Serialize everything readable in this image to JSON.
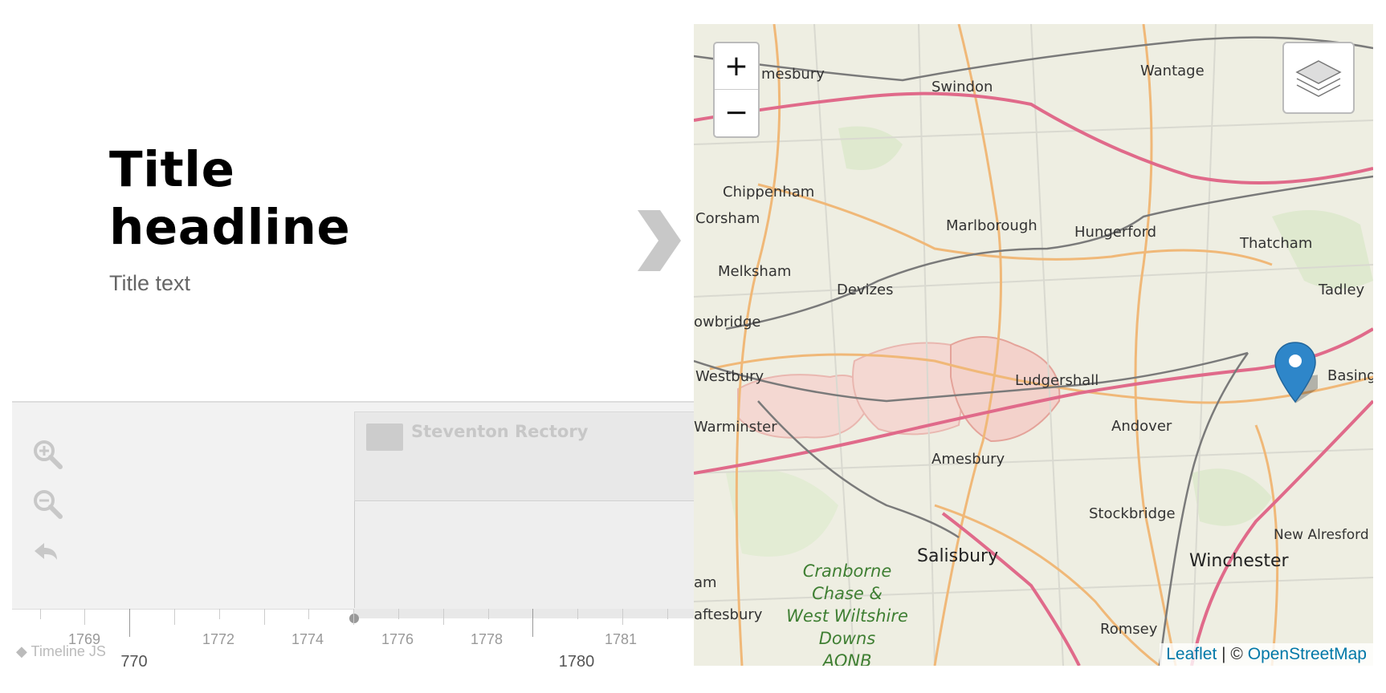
{
  "slide": {
    "headline_line1": "Title",
    "headline_line2": "headline",
    "text": "Title text"
  },
  "nav": {
    "zoom_in_icon": "zoom-in-icon",
    "zoom_out_icon": "zoom-out-icon",
    "back_icon": "back-icon",
    "marker_title": "Steventon Rectory",
    "axis_minor_labels": [
      "1769",
      "1772",
      "1774",
      "1776",
      "1778",
      "1781"
    ],
    "axis_major_labels": [
      "770",
      "1780"
    ],
    "credit": "◆ Timeline JS"
  },
  "map": {
    "zoom_in_label": "+",
    "zoom_out_label": "−",
    "attribution_leaflet": "Leaflet",
    "attribution_sep": " | © ",
    "attribution_osm": "OpenStreetMap",
    "places": [
      {
        "name": "Swindon",
        "major": false
      },
      {
        "name": "Wantage",
        "major": false
      },
      {
        "name": "mesbury",
        "major": false
      },
      {
        "name": "Chippenham",
        "major": false
      },
      {
        "name": "Corsham",
        "major": false
      },
      {
        "name": "Marlborough",
        "major": false
      },
      {
        "name": "Hungerford",
        "major": false
      },
      {
        "name": "Thatcham",
        "major": false
      },
      {
        "name": "Melksham",
        "major": false
      },
      {
        "name": "Devizes",
        "major": false
      },
      {
        "name": "Tadley",
        "major": false
      },
      {
        "name": "owbridge",
        "major": false
      },
      {
        "name": "Westbury",
        "major": false
      },
      {
        "name": "Ludgershall",
        "major": false
      },
      {
        "name": "Basing",
        "major": false
      },
      {
        "name": "Warminster",
        "major": false
      },
      {
        "name": "Andover",
        "major": false
      },
      {
        "name": "Amesbury",
        "major": false
      },
      {
        "name": "Stockbridge",
        "major": false
      },
      {
        "name": "New Alresford",
        "major": false
      },
      {
        "name": "Salisbury",
        "major": true
      },
      {
        "name": "Winchester",
        "major": true
      },
      {
        "name": "Romsey",
        "major": false
      },
      {
        "name": "aftesbury",
        "major": false
      },
      {
        "name": "am",
        "major": false
      },
      {
        "name": "Cranborne",
        "major": false
      },
      {
        "name": "Chase &",
        "major": false
      },
      {
        "name": "West Wiltshire",
        "major": false
      },
      {
        "name": "Downs",
        "major": false
      },
      {
        "name": "AONB",
        "major": false
      }
    ]
  },
  "colors": {
    "map_bg": "#f1efe6",
    "road_red": "#e06a8a",
    "road_orange": "#f0b878",
    "rail": "#777777",
    "pin": "#2e86c9",
    "protected_area": "#f4c7c3",
    "aonb_text": "#4a8a3a"
  }
}
